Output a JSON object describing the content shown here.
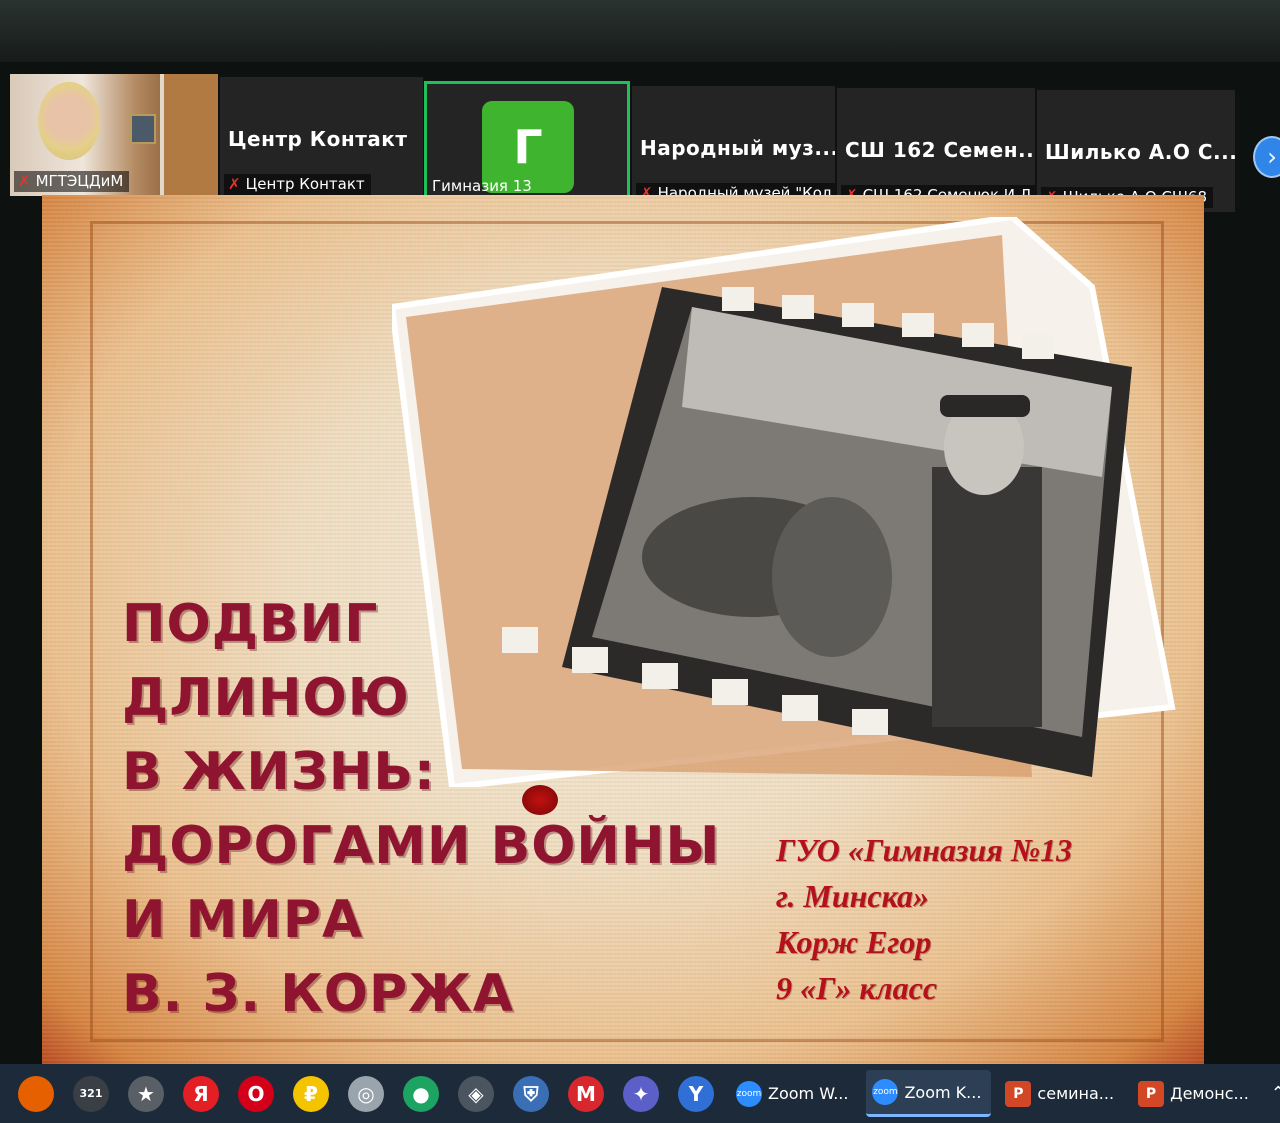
{
  "participants": [
    {
      "label": "МГТЭЦДиМ",
      "muted": true,
      "type": "video"
    },
    {
      "name": "Центр Контакт",
      "label": "Центр Контакт",
      "muted": true,
      "type": "name"
    },
    {
      "avatar_letter": "Г",
      "label": "Гимназия 13",
      "muted": false,
      "type": "avatar",
      "active": true
    },
    {
      "name": "Народный муз...",
      "label": "Народный музей \"Кол...",
      "muted": true,
      "type": "name"
    },
    {
      "name": "СШ 162 Семен...",
      "label": "СШ 162 Семенюк И.Л.",
      "muted": true,
      "type": "name"
    },
    {
      "name": "Шилько А.О С...",
      "label": "Шилько А.О СШ68",
      "muted": true,
      "type": "name"
    }
  ],
  "next_icon": "chevron-right-icon",
  "slide": {
    "title_lines": [
      "ПОДВИГ",
      "ДЛИНОЮ",
      "В ЖИЗНЬ:",
      "ДОРОГАМИ ВОЙНЫ",
      "И МИРА",
      "В. З. КОРЖА"
    ],
    "credits_lines": [
      "ГУО «Гимназия №13",
      "г. Минска»",
      "Корж Егор",
      "9 «Г» класс"
    ],
    "title_color": "#8f1430",
    "credits_color": "#b5111c"
  },
  "taskbar": {
    "icons": [
      {
        "name": "firefox-icon",
        "glyph": "",
        "bg": "#e66000"
      },
      {
        "name": "video-editor-icon",
        "glyph": "321",
        "bg": "#3a3f45"
      },
      {
        "name": "movie-maker-icon",
        "glyph": "★",
        "bg": "#5a5f66"
      },
      {
        "name": "yandex-browser-icon",
        "glyph": "Я",
        "bg": "#e31e24"
      },
      {
        "name": "opera-icon",
        "glyph": "O",
        "bg": "#d4001a"
      },
      {
        "name": "yandex-market-icon",
        "glyph": "₽",
        "bg": "#f5c400"
      },
      {
        "name": "disc-burner-icon",
        "glyph": "◎",
        "bg": "#9aa4ad"
      },
      {
        "name": "chrome-icon",
        "glyph": "●",
        "bg": "#1da462"
      },
      {
        "name": "shield-app-icon",
        "glyph": "◈",
        "bg": "#4a5560"
      },
      {
        "name": "security-icon",
        "glyph": "⛨",
        "bg": "#3b6fb5"
      },
      {
        "name": "mega-icon",
        "glyph": "M",
        "bg": "#d9272e"
      },
      {
        "name": "gamepad-icon",
        "glyph": "✦",
        "bg": "#5b5fc7"
      },
      {
        "name": "yammer-icon",
        "glyph": "Y",
        "bg": "#2f6fd6"
      }
    ],
    "apps": [
      {
        "name": "zoom-window-1",
        "label": "Zoom W...",
        "icon_bg": "#2d8cff",
        "icon_text": "zoom",
        "active": false
      },
      {
        "name": "zoom-window-2",
        "label": "Zoom K...",
        "icon_bg": "#2d8cff",
        "icon_text": "zoom",
        "active": true
      },
      {
        "name": "powerpoint-window-1",
        "label": "семина...",
        "icon_bg": "#d24726",
        "icon_text": "P",
        "active": false
      },
      {
        "name": "powerpoint-window-2",
        "label": "Демонс...",
        "icon_bg": "#d24726",
        "icon_text": "P",
        "active": false
      }
    ]
  }
}
